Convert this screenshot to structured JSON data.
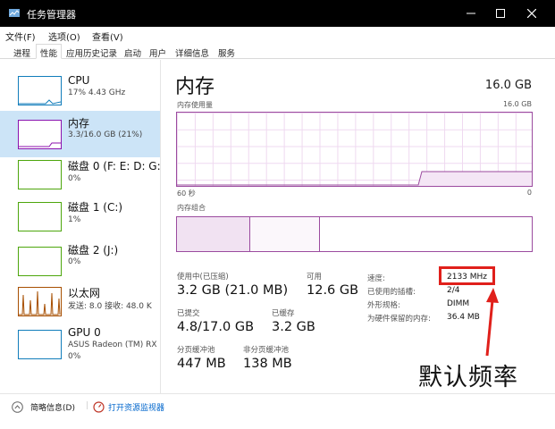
{
  "window": {
    "title": "任务管理器"
  },
  "menu": {
    "file": "文件(F)",
    "options": "选项(O)",
    "view": "查看(V)"
  },
  "tabs": [
    "进程",
    "性能",
    "应用历史记录",
    "启动",
    "用户",
    "详细信息",
    "服务"
  ],
  "sidebar": {
    "items": [
      {
        "name": "CPU",
        "detail": "17% 4.43 GHz",
        "color": "#117dbb"
      },
      {
        "name": "内存",
        "detail": "3.3/16.0 GB (21%)",
        "color": "#8b12ae"
      },
      {
        "name": "磁盘 0 (F: E: D: G:",
        "detail": "0%",
        "color": "#4da60c"
      },
      {
        "name": "磁盘 1 (C:)",
        "detail": "1%",
        "color": "#4da60c"
      },
      {
        "name": "磁盘 2 (J:)",
        "detail": "0%",
        "color": "#4da60c"
      },
      {
        "name": "以太网",
        "detail": "发送: 8.0 接收: 48.0 K",
        "color": "#a74f01"
      },
      {
        "name": "GPU 0",
        "detail": "ASUS Radeon (TM) RX",
        "detail2": "0%",
        "color": "#117dbb"
      }
    ]
  },
  "memory": {
    "title": "内存",
    "total": "16.0 GB",
    "usage_label": "内存使用量",
    "usage_max": "16.0 GB",
    "time_left": "60 秒",
    "time_right": "0",
    "composition_label": "内存组合",
    "accent": "#9b4b9f",
    "usage_fraction": 0.21
  },
  "stats": {
    "in_use_label": "使用中(已压缩)",
    "in_use_value": "3.2 GB (21.0 MB)",
    "available_label": "可用",
    "available_value": "12.6 GB",
    "committed_label": "已提交",
    "committed_value": "4.8/17.0 GB",
    "cached_label": "已缓存",
    "cached_value": "3.2 GB",
    "paged_label": "分页缓冲池",
    "paged_value": "447 MB",
    "nonpaged_label": "非分页缓冲池",
    "nonpaged_value": "138 MB"
  },
  "details": [
    {
      "label": "速度:",
      "value": "2133 MHz"
    },
    {
      "label": "已使用的插槽:",
      "value": "2/4"
    },
    {
      "label": "外形规格:",
      "value": "DIMM"
    },
    {
      "label": "为硬件保留的内存:",
      "value": "36.4 MB"
    }
  ],
  "annotation": {
    "text": "默认频率",
    "color": "#e0201b"
  },
  "footer": {
    "brief": "简略信息(D)",
    "monitor": "打开资源监视器"
  }
}
